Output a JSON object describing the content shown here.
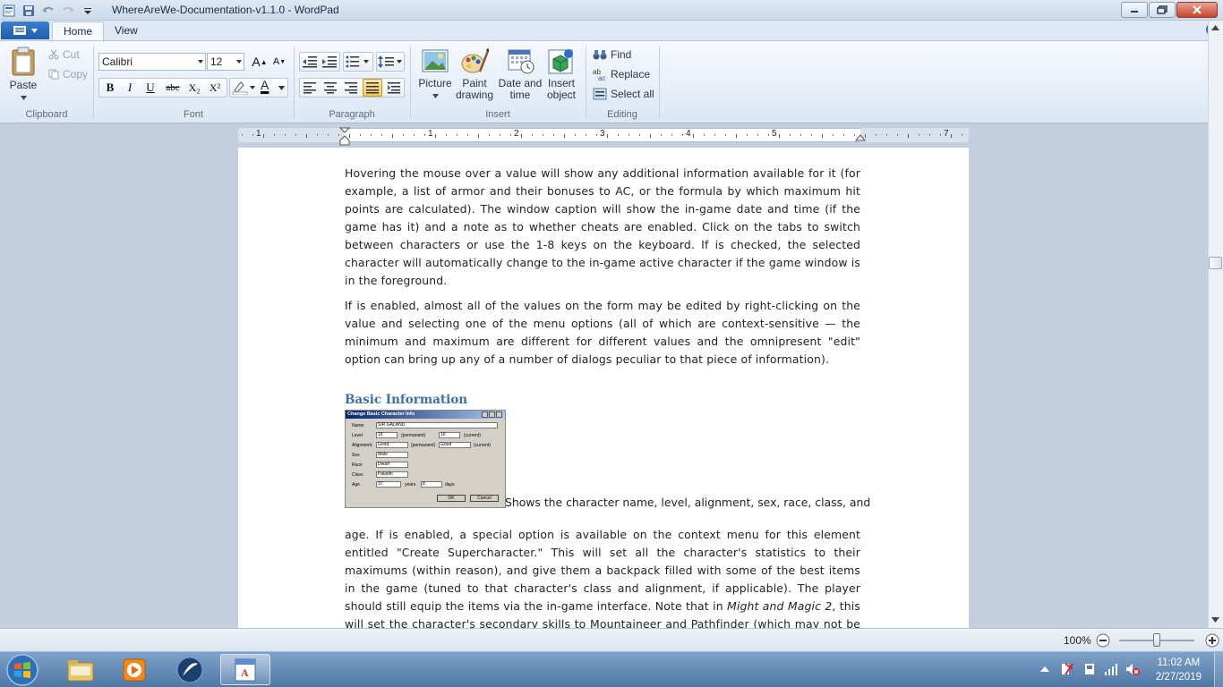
{
  "window": {
    "title": "WhereAreWe-Documentation-v1.1.0 - WordPad"
  },
  "tabs": [
    {
      "label": "Home"
    },
    {
      "label": "View"
    }
  ],
  "ribbon": {
    "clipboard": {
      "paste": "Paste",
      "cut": "Cut",
      "copy": "Copy",
      "group": "Clipboard"
    },
    "font": {
      "family": "Calibri",
      "size": "12",
      "group": "Font",
      "bold": "B",
      "italic": "I",
      "underline": "U",
      "strike": "abc",
      "subscript": "X₂",
      "superscript": "X²",
      "grow": "A",
      "shrink": "A"
    },
    "paragraph": {
      "group": "Paragraph"
    },
    "insert": {
      "picture": "Picture",
      "paint_1": "Paint",
      "paint_2": "drawing",
      "date_1": "Date and",
      "date_2": "time",
      "object_1": "Insert",
      "object_2": "object",
      "group": "Insert"
    },
    "editing": {
      "find": "Find",
      "replace": "Replace",
      "select_all": "Select all",
      "group": "Editing"
    }
  },
  "ruler": {
    "numbers": [
      "1",
      "1",
      "2",
      "3",
      "4",
      "5",
      "7"
    ]
  },
  "document": {
    "para1": "Hovering the mouse over a value will show any additional information available for it (for example, a list of armor and their bonuses to AC, or the formula by which maximum hit points are calculated).  The window caption will show the in-game date and time (if the game has it) and a note as to whether cheats are enabled.  Click on the tabs to switch between characters or use the 1-8 keys on the keyboard.  If  is checked, the selected character will automatically change to the in-game active character if the game window is in the foreground.",
    "para2": "If  is enabled, almost all of the values on the form may be edited by right-clicking on the value and selecting one of the menu options (all of which are context-sensitive — the minimum and maximum are different for different values and the omnipresent \"edit\" option can bring up any of a number of dialogs peculiar to that piece of information).",
    "heading": "Basic Information",
    "caption_inline": "Shows the character name, level, alignment, sex, race, class, and",
    "para3_a": "age.  If  is enabled, a special option is available on the context menu for this element entitled \"Create Supercharacter.\"  This will set all the character's statistics to their maximums (within reason), and give them a backpack filled with some of the best items in the game (tuned to that character's class and alignment, if applicable).  The player should still equip the items via the in-game interface.  Note that in ",
    "para3_italic": "Might and Magic 2",
    "para3_b": ", this will set the character's secondary skills to Mountaineer and Pathfinder (which may not be what you want for all characters in",
    "dialog": {
      "title": "Change Basic Character Info",
      "name_label": "Name",
      "name_value": "SIR GALAND",
      "level_label": "Level",
      "level_perm": "16",
      "level_perm_note": "(permanent)",
      "level_cur": "16",
      "level_cur_note": "(current)",
      "align_label": "Alignment",
      "align_perm": "Good",
      "align_perm_note": "(permanent)",
      "align_cur": "Good",
      "align_cur_note": "(current)",
      "sex_label": "Sex",
      "sex_value": "Male",
      "race_label": "Race",
      "race_value": "Dwarf",
      "class_label": "Class",
      "class_value": "Paladin",
      "age_label": "Age",
      "age_years": "37",
      "years": "years",
      "age_days": "8",
      "days": "days",
      "ok": "OK",
      "cancel": "Cancel"
    }
  },
  "status": {
    "zoom": "100%"
  },
  "taskbar": {
    "time": "11:02 AM",
    "date": "2/27/2019"
  }
}
